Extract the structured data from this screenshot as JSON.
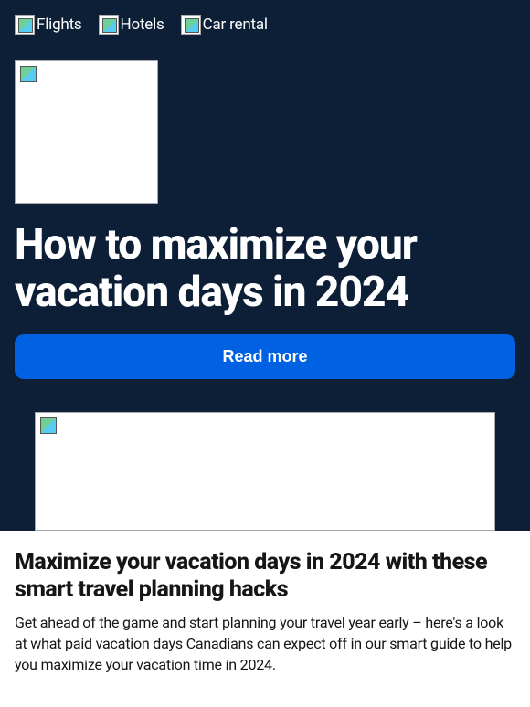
{
  "nav": {
    "items": [
      {
        "label": "Flights"
      },
      {
        "label": "Hotels"
      },
      {
        "label": "Car rental"
      }
    ]
  },
  "hero": {
    "headline": "How to maximize your vacation days in 2024",
    "cta_label": "Read more"
  },
  "article": {
    "title": "Maximize your vacation days in 2024 with these smart travel planning hacks",
    "body": "Get ahead of the game and start planning your travel year early – here's a look at what paid vacation days Canadians can expect off in our smart guide to help you maximize your vacation time in 2024."
  }
}
